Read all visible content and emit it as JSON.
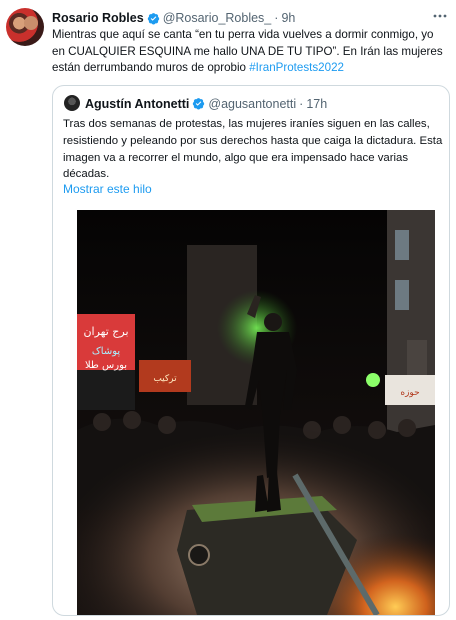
{
  "tweet": {
    "author_name": "Rosario Robles",
    "author_handle": "@Rosario_Robles_",
    "separator": "·",
    "time": "9h",
    "more_icon": "more-horizontal-icon",
    "text_main": "Mientras que aquí se canta “en tu perra vida vuelves a dormir conmigo, yo en CUALQUIER ESQUINA me hallo UNA DE TU TIPO”. En Irán las mujeres están derrumbando muros de oprobio ",
    "hashtag": "#IranProtests2022"
  },
  "quoted": {
    "author_name": "Agustín Antonetti",
    "author_handle": "@agusantonetti",
    "separator": "·",
    "time": "17h",
    "text": "Tras dos semanas de protestas, las mujeres iraníes siguen en las calles, resistiendo y peleando por sus derechos hasta que caiga la dictadura. Esta imagen va a recorrer el mundo, algo que era impensado hace varias décadas.",
    "show_thread": "Mostrar este hilo",
    "photo_signs": [
      "برج تهران",
      "پوشاک",
      "بورس طلا",
      "حوزه",
      "ترکیب"
    ]
  },
  "colors": {
    "link": "#1d9bf0",
    "verified": "#1d9bf0",
    "muted": "#536471",
    "border": "#cfd9de"
  }
}
